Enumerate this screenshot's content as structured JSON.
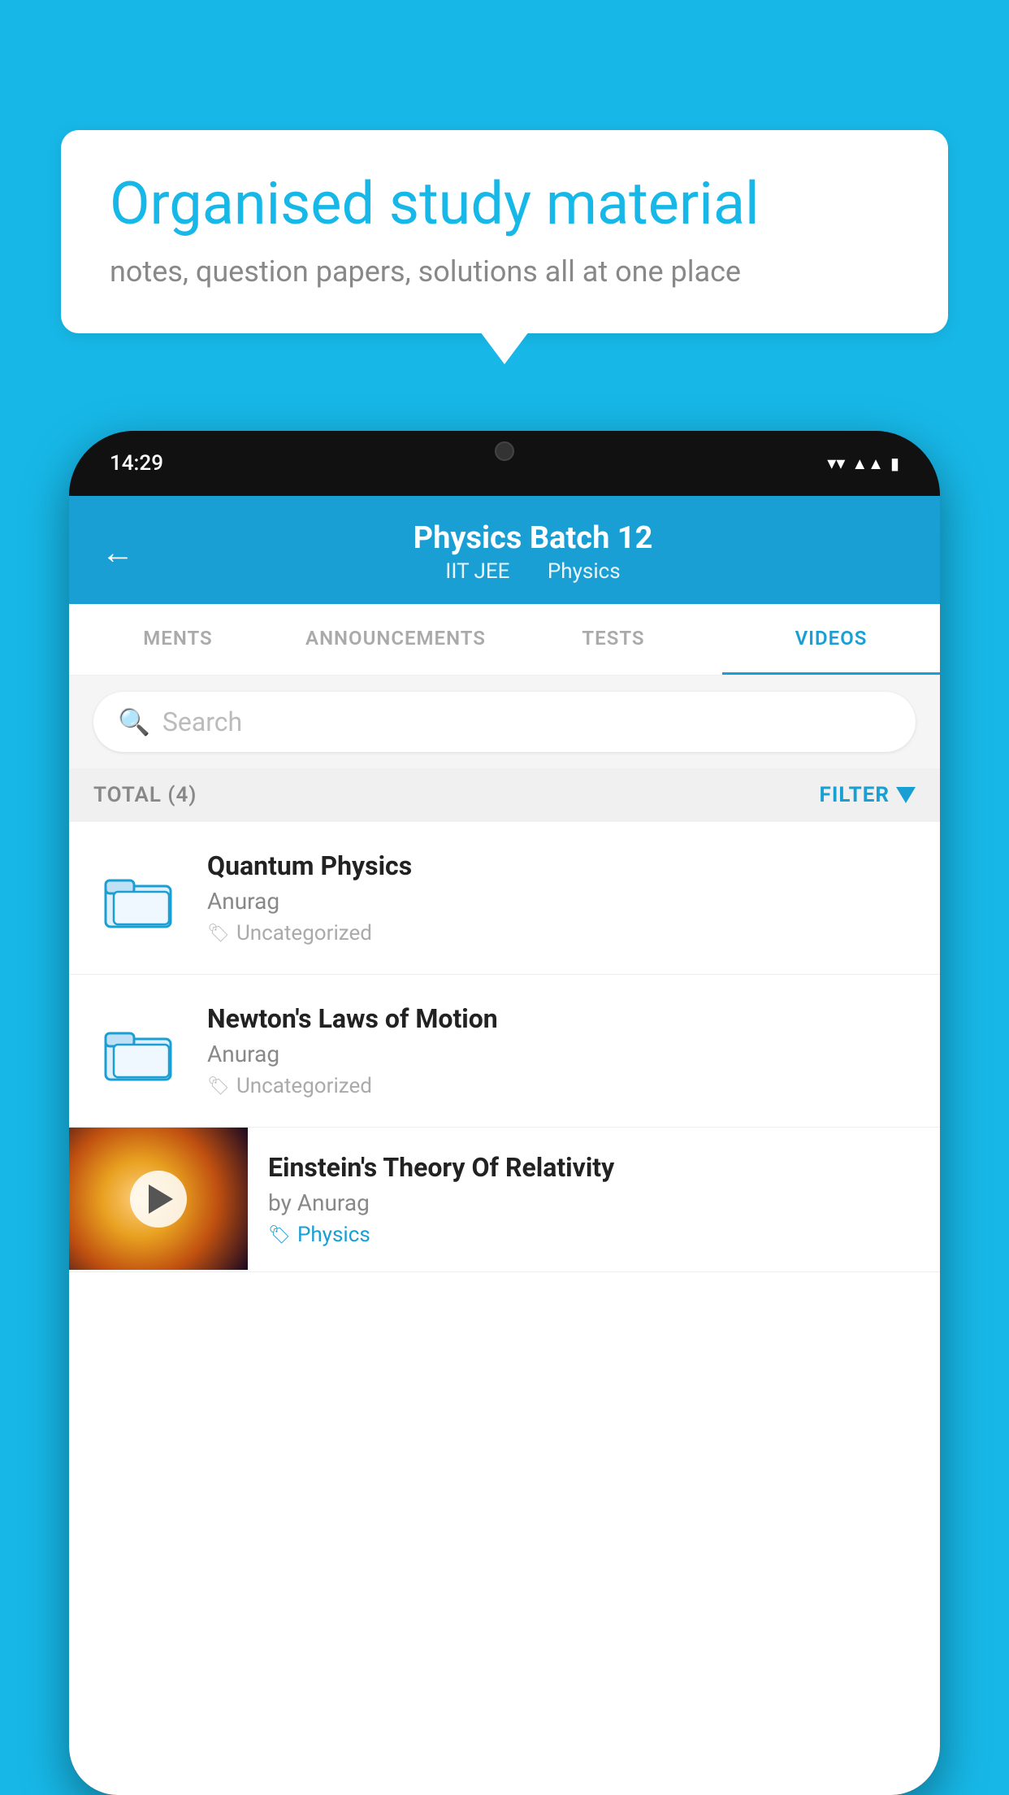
{
  "background_color": "#17b8e8",
  "bubble": {
    "title": "Organised study material",
    "subtitle": "notes, question papers, solutions all at one place"
  },
  "phone": {
    "status_time": "14:29",
    "header": {
      "back_label": "←",
      "title": "Physics Batch 12",
      "tag1": "IIT JEE",
      "tag2": "Physics"
    },
    "tabs": [
      {
        "label": "MENTS",
        "active": false
      },
      {
        "label": "ANNOUNCEMENTS",
        "active": false
      },
      {
        "label": "TESTS",
        "active": false
      },
      {
        "label": "VIDEOS",
        "active": true
      }
    ],
    "search": {
      "placeholder": "Search"
    },
    "filter_row": {
      "total_label": "TOTAL (4)",
      "filter_label": "FILTER"
    },
    "videos": [
      {
        "id": 1,
        "title": "Quantum Physics",
        "author": "Anurag",
        "tag": "Uncategorized",
        "type": "folder"
      },
      {
        "id": 2,
        "title": "Newton's Laws of Motion",
        "author": "Anurag",
        "tag": "Uncategorized",
        "type": "folder"
      },
      {
        "id": 3,
        "title": "Einstein's Theory Of Relativity",
        "author": "by Anurag",
        "tag": "Physics",
        "type": "video"
      }
    ]
  }
}
